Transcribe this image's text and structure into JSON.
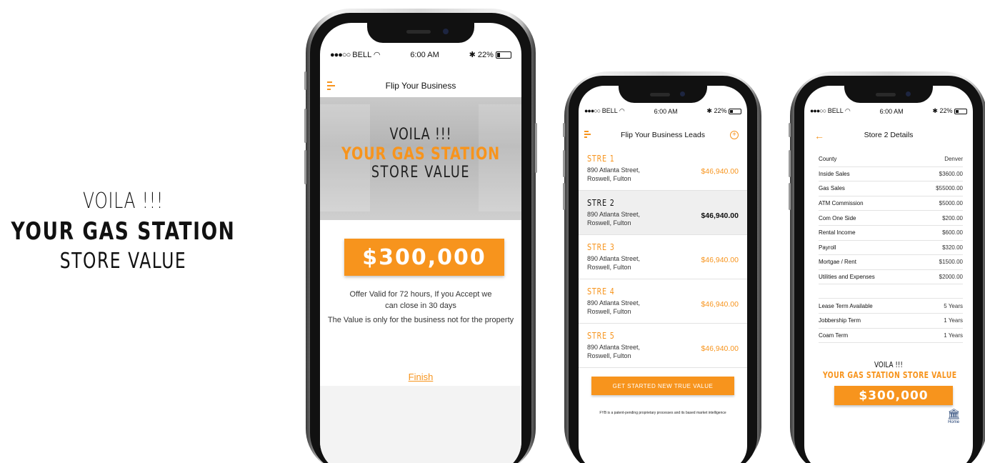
{
  "hero": {
    "line1": "VOILA !!!",
    "line2": "YOUR GAS STATION",
    "line3": "STORE VALUE"
  },
  "colors": {
    "accent": "#f7941d",
    "text": "#111111",
    "home_icon": "#1a3a6e"
  },
  "phone1": {
    "status": {
      "carrier": "BELL",
      "signal": "●●●○○",
      "time": "6:00 AM",
      "battery": "22%",
      "battery_level": 0.22
    },
    "nav_title": "Flip Your Business",
    "banner": {
      "line1": "VOILA !!!",
      "line2": "YOUR GAS STATION",
      "line3": "STORE VALUE"
    },
    "value": "$300,000",
    "offer": "Offer Valid for 72 hours, If you Accept we can close in 30 days",
    "note": "The Value is only for the business not for the property",
    "finish": "Finish"
  },
  "phone2": {
    "status": {
      "carrier": "BELL",
      "signal": "●●●○○",
      "time": "6:00 AM",
      "battery": "22%",
      "battery_level": 0.22
    },
    "nav_title": "Flip Your Business Leads",
    "leads": [
      {
        "name": "STRE 1",
        "address1": "890 Atlanta Street,",
        "address2": "Roswell, Fulton",
        "price": "$46,940.00",
        "selected": false
      },
      {
        "name": "STRE 2",
        "address1": "890 Atlanta Street,",
        "address2": "Roswell, Fulton",
        "price": "$46,940.00",
        "selected": true
      },
      {
        "name": "STRE 3",
        "address1": "890 Atlanta Street,",
        "address2": "Roswell, Fulton",
        "price": "$46,940.00",
        "selected": false
      },
      {
        "name": "STRE 4",
        "address1": "890 Atlanta Street,",
        "address2": "Roswell, Fulton",
        "price": "$46,940.00",
        "selected": false
      },
      {
        "name": "STRE 5",
        "address1": "890 Atlanta Street,",
        "address2": "Roswell, Fulton",
        "price": "$46,940.00",
        "selected": false
      }
    ],
    "cta": "GET STARTED NEW TRUE VALUE",
    "disclaimer": "FYB is a patent-pending proprietary processes and its based market intelligence"
  },
  "phone3": {
    "status": {
      "carrier": "BELL",
      "signal": "●●●○○",
      "time": "6:00 AM",
      "battery": "22%",
      "battery_level": 0.22
    },
    "nav_title": "Store 2 Details",
    "details": [
      {
        "label": "County",
        "value": "Denver"
      },
      {
        "label": "Inside Sales",
        "value": "$3600.00"
      },
      {
        "label": "Gas Sales",
        "value": "$55000.00"
      },
      {
        "label": "ATM Commission",
        "value": "$5000.00"
      },
      {
        "label": "Com One Side",
        "value": "$200.00"
      },
      {
        "label": "Rental Income",
        "value": "$600.00"
      },
      {
        "label": "Payroll",
        "value": "$320.00"
      },
      {
        "label": "Mortgae / Rent",
        "value": "$1500.00"
      },
      {
        "label": "Utilities and Expenses",
        "value": "$2000.00"
      }
    ],
    "terms": [
      {
        "label": "Lease Term Available",
        "value": "5 Years"
      },
      {
        "label": "Jobbership Term",
        "value": "1 Years"
      },
      {
        "label": "Coam Term",
        "value": "1 Years"
      }
    ],
    "voila": "VOILA !!!",
    "headline": "YOUR GAS STATION STORE VALUE",
    "value": "$300,000",
    "home_label": "Home",
    "icons": {
      "back": "arrow-left-icon",
      "home": "bank-icon"
    }
  }
}
